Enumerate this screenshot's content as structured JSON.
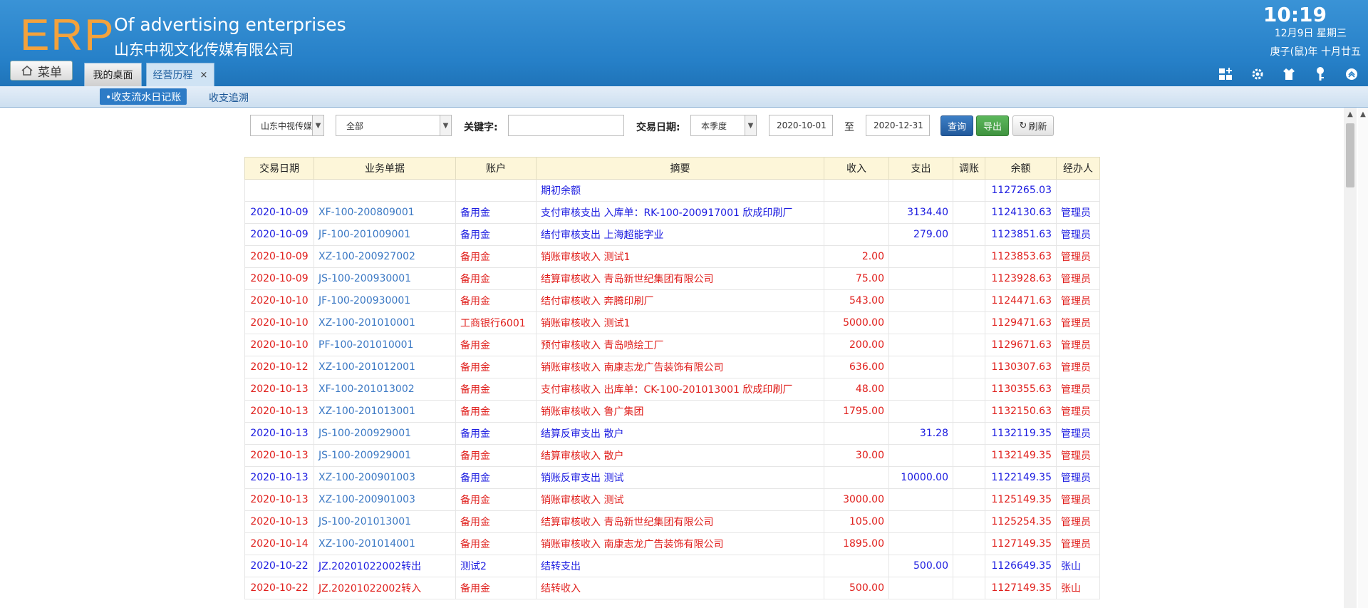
{
  "app": {
    "logo": "ERP",
    "title_en": "Of advertising enterprises",
    "title_cn": "山东中视文化传媒有限公司"
  },
  "clock": {
    "time": "10:19",
    "date": "12月9日 星期三",
    "lunar": "庚子(鼠)年 十月廿五"
  },
  "menu_label": "菜单",
  "tabs": [
    {
      "label": "我的桌面"
    },
    {
      "label": "经营历程",
      "close": "×"
    }
  ],
  "toolbar_icons": [
    "grid-add-icon",
    "gear-icon",
    "shirt-icon",
    "key-icon",
    "collapse-icon"
  ],
  "subnav": {
    "active": "•收支流水日记账",
    "other": "收支追溯"
  },
  "filters": {
    "company": "山东中视传媒",
    "account": "全部",
    "keyword_label": "关键字:",
    "keyword_value": "",
    "date_label": "交易日期:",
    "period": "本季度",
    "date_from": "2020-10-01",
    "to_label": "至",
    "date_to": "2020-12-31",
    "query": "查询",
    "export": "导出",
    "refresh": "刷新"
  },
  "columns": [
    "交易日期",
    "业务单据",
    "账户",
    "摘要",
    "收入",
    "支出",
    "调账",
    "余额",
    "经办人"
  ],
  "rows": [
    {
      "type": "open",
      "date": "",
      "doc": "",
      "account": "",
      "summary": "期初余额",
      "income": "",
      "expense": "",
      "adjust": "",
      "balance": "1127265.03",
      "handler": ""
    },
    {
      "type": "out",
      "date": "2020-10-09",
      "doc": "XF-100-200809001",
      "account": "备用金",
      "summary": "支付审核支出 入库单：RK-100-200917001 欣成印刷厂",
      "income": "",
      "expense": "3134.40",
      "adjust": "",
      "balance": "1124130.63",
      "handler": "管理员"
    },
    {
      "type": "out",
      "date": "2020-10-09",
      "doc": "JF-100-201009001",
      "account": "备用金",
      "summary": "结付审核支出 上海超能字业",
      "income": "",
      "expense": "279.00",
      "adjust": "",
      "balance": "1123851.63",
      "handler": "管理员"
    },
    {
      "type": "in",
      "date": "2020-10-09",
      "doc": "XZ-100-200927002",
      "account": "备用金",
      "summary": "销账审核收入 测试1",
      "income": "2.00",
      "expense": "",
      "adjust": "",
      "balance": "1123853.63",
      "handler": "管理员"
    },
    {
      "type": "in",
      "date": "2020-10-09",
      "doc": "JS-100-200930001",
      "account": "备用金",
      "summary": "结算审核收入 青岛新世纪集团有限公司",
      "income": "75.00",
      "expense": "",
      "adjust": "",
      "balance": "1123928.63",
      "handler": "管理员"
    },
    {
      "type": "in",
      "date": "2020-10-10",
      "doc": "JF-100-200930001",
      "account": "备用金",
      "summary": "结付审核收入 奔腾印刷厂",
      "income": "543.00",
      "expense": "",
      "adjust": "",
      "balance": "1124471.63",
      "handler": "管理员"
    },
    {
      "type": "in",
      "date": "2020-10-10",
      "doc": "XZ-100-201010001",
      "account": "工商银行6001",
      "summary": "销账审核收入 测试1",
      "income": "5000.00",
      "expense": "",
      "adjust": "",
      "balance": "1129471.63",
      "handler": "管理员"
    },
    {
      "type": "in",
      "date": "2020-10-10",
      "doc": "PF-100-201010001",
      "account": "备用金",
      "summary": "预付审核收入 青岛喷绘工厂",
      "income": "200.00",
      "expense": "",
      "adjust": "",
      "balance": "1129671.63",
      "handler": "管理员"
    },
    {
      "type": "in",
      "date": "2020-10-12",
      "doc": "XZ-100-201012001",
      "account": "备用金",
      "summary": "销账审核收入 南康志龙广告装饰有限公司",
      "income": "636.00",
      "expense": "",
      "adjust": "",
      "balance": "1130307.63",
      "handler": "管理员"
    },
    {
      "type": "in",
      "date": "2020-10-13",
      "doc": "XF-100-201013002",
      "account": "备用金",
      "summary": "支付审核收入 出库单：CK-100-201013001 欣成印刷厂",
      "income": "48.00",
      "expense": "",
      "adjust": "",
      "balance": "1130355.63",
      "handler": "管理员"
    },
    {
      "type": "in",
      "date": "2020-10-13",
      "doc": "XZ-100-201013001",
      "account": "备用金",
      "summary": "销账审核收入 鲁广集团",
      "income": "1795.00",
      "expense": "",
      "adjust": "",
      "balance": "1132150.63",
      "handler": "管理员"
    },
    {
      "type": "out",
      "date": "2020-10-13",
      "doc": "JS-100-200929001",
      "account": "备用金",
      "summary": "结算反审支出 散户",
      "income": "",
      "expense": "31.28",
      "adjust": "",
      "balance": "1132119.35",
      "handler": "管理员"
    },
    {
      "type": "in",
      "date": "2020-10-13",
      "doc": "JS-100-200929001",
      "account": "备用金",
      "summary": "结算审核收入 散户",
      "income": "30.00",
      "expense": "",
      "adjust": "",
      "balance": "1132149.35",
      "handler": "管理员"
    },
    {
      "type": "out",
      "date": "2020-10-13",
      "doc": "XZ-100-200901003",
      "account": "备用金",
      "summary": "销账反审支出 测试",
      "income": "",
      "expense": "10000.00",
      "adjust": "",
      "balance": "1122149.35",
      "handler": "管理员"
    },
    {
      "type": "in",
      "date": "2020-10-13",
      "doc": "XZ-100-200901003",
      "account": "备用金",
      "summary": "销账审核收入 测试",
      "income": "3000.00",
      "expense": "",
      "adjust": "",
      "balance": "1125149.35",
      "handler": "管理员"
    },
    {
      "type": "in",
      "date": "2020-10-13",
      "doc": "JS-100-201013001",
      "account": "备用金",
      "summary": "结算审核收入 青岛新世纪集团有限公司",
      "income": "105.00",
      "expense": "",
      "adjust": "",
      "balance": "1125254.35",
      "handler": "管理员"
    },
    {
      "type": "in",
      "date": "2020-10-14",
      "doc": "XZ-100-201014001",
      "account": "备用金",
      "summary": "销账审核收入 南康志龙广告装饰有限公司",
      "income": "1895.00",
      "expense": "",
      "adjust": "",
      "balance": "1127149.35",
      "handler": "管理员"
    },
    {
      "type": "out",
      "date": "2020-10-22",
      "doc": "JZ.20201022002转出",
      "account": "测试2",
      "summary": "结转支出",
      "income": "",
      "expense": "500.00",
      "adjust": "",
      "balance": "1126649.35",
      "handler": "张山",
      "doc_plain": true
    },
    {
      "type": "in",
      "date": "2020-10-22",
      "doc": "JZ.20201022002转入",
      "account": "备用金",
      "summary": "结转收入",
      "income": "500.00",
      "expense": "",
      "adjust": "",
      "balance": "1127149.35",
      "handler": "张山",
      "doc_plain": true
    }
  ]
}
